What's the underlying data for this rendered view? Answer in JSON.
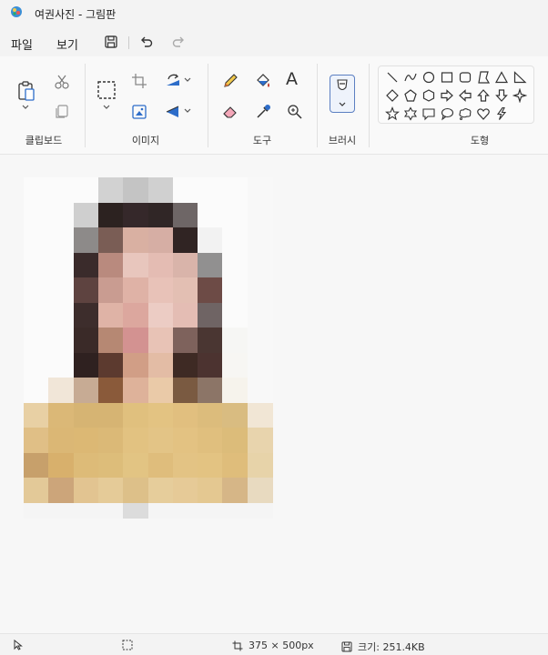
{
  "window": {
    "title": "여권사진 - 그림판"
  },
  "menu": {
    "file": "파일",
    "view": "보기"
  },
  "ribbon": {
    "groups": {
      "clipboard": "클립보드",
      "image": "이미지",
      "tools": "도구",
      "brushes": "브러시",
      "shapes": "도형"
    },
    "text_tool_glyph": "A"
  },
  "status": {
    "dimensions": "375 × 500px",
    "size": "크기: 251.4KB"
  },
  "colors": {
    "accent": "#2d6dc9",
    "hair": "#2f2320",
    "skin": "#d9b0a2",
    "shirt": "#dcbc78"
  }
}
